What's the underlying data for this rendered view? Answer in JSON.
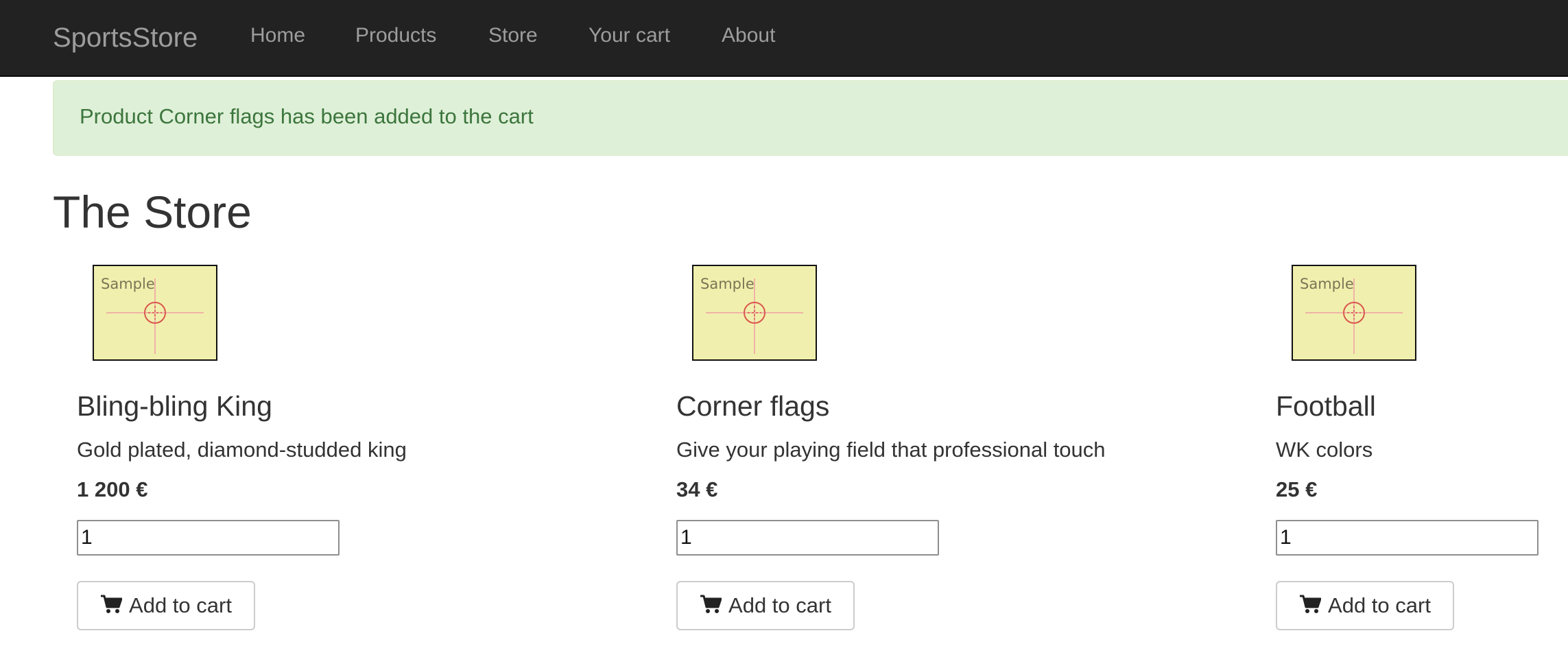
{
  "navbar": {
    "brand": "SportsStore",
    "links": [
      "Home",
      "Products",
      "Store",
      "Your cart",
      "About"
    ]
  },
  "alert": {
    "message": "Product Corner flags has been added to the cart"
  },
  "page": {
    "title": "The Store"
  },
  "products": [
    {
      "image_label": "Sample",
      "name": "Bling-bling King",
      "description": "Gold plated, diamond-studded king",
      "price": "1 200 €",
      "quantity": "1",
      "button_label": "Add to cart"
    },
    {
      "image_label": "Sample",
      "name": "Corner flags",
      "description": "Give your playing field that professional touch",
      "price": "34 €",
      "quantity": "1",
      "button_label": "Add to cart"
    },
    {
      "image_label": "Sample",
      "name": "Football",
      "description": "WK colors",
      "price": "25 €",
      "quantity": "1",
      "button_label": "Add to cart"
    }
  ],
  "icons": {
    "button": "cart-icon",
    "thumbnail": "crosshair-icon"
  },
  "colors": {
    "navbar_bg": "#222222",
    "nav_text": "#9d9d9d",
    "alert_bg": "#dff0d8",
    "alert_text": "#3c763d",
    "thumbnail_bg": "#f1efad"
  }
}
